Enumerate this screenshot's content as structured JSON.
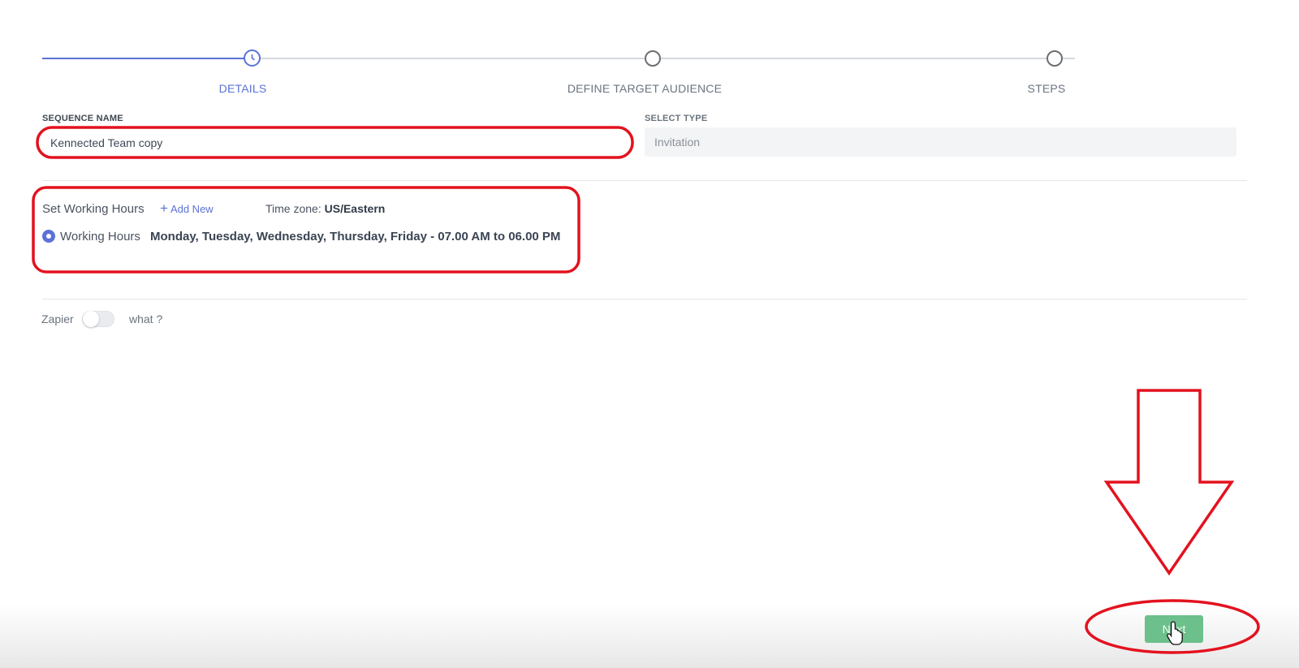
{
  "stepper": {
    "steps": [
      {
        "label": "DETAILS",
        "state": "active"
      },
      {
        "label": "DEFINE TARGET AUDIENCE",
        "state": "pending"
      },
      {
        "label": "STEPS",
        "state": "pending"
      }
    ]
  },
  "form": {
    "sequence_name_label": "SEQUENCE NAME",
    "sequence_name_value": "Kennected Team copy",
    "select_type_label": "SELECT TYPE",
    "select_type_value": "Invitation"
  },
  "working_hours": {
    "title": "Set Working Hours",
    "add_new_plus": "+",
    "add_new_label": "Add New",
    "timezone_prefix": "Time zone:",
    "timezone_value": "US/Eastern",
    "option_name": "Working Hours",
    "option_detail": "Monday, Tuesday, Wednesday, Thursday, Friday - 07.00 AM to 06.00 PM",
    "option_selected": true
  },
  "zapier": {
    "label": "Zapier",
    "enabled": false,
    "help_text": "what ?"
  },
  "footer": {
    "next_label": "Next"
  },
  "colors": {
    "accent": "#5b72d6",
    "next_button": "#6cc08b",
    "annotation": "#e3121f"
  },
  "icons": {
    "active_step": "clock-icon",
    "cursor": "hand-pointer-icon"
  }
}
